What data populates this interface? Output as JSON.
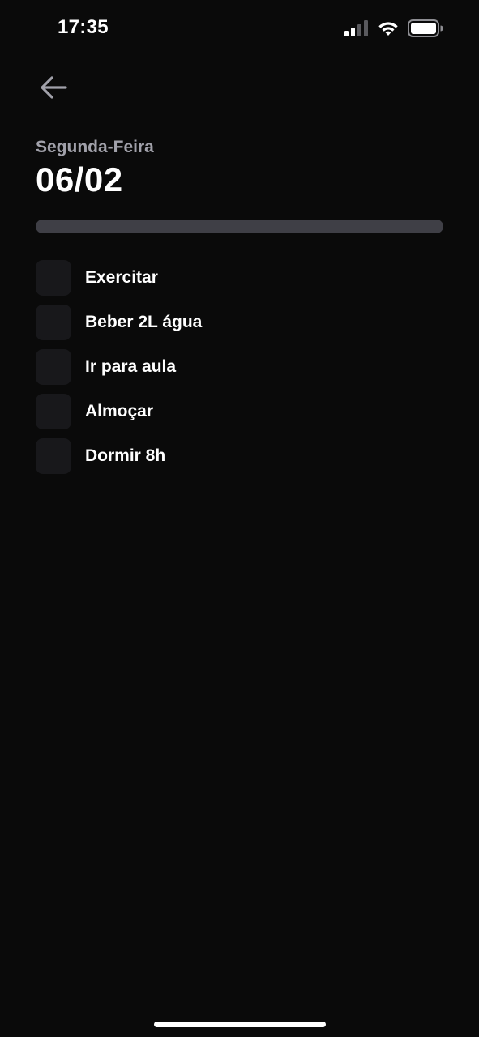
{
  "status_bar": {
    "time": "17:35",
    "icons": [
      "cellular-signal-icon",
      "wifi-icon",
      "battery-icon"
    ]
  },
  "header": {
    "back_icon": "arrow-left-icon",
    "weekday": "Segunda-Feira",
    "date": "06/02"
  },
  "progress": {
    "completed_fraction": 0,
    "track_color": "#3f3f46",
    "fill_color": "#7c3aed"
  },
  "habits": [
    {
      "label": "Exercitar",
      "checked": false
    },
    {
      "label": "Beber 2L água",
      "checked": false
    },
    {
      "label": "Ir para aula",
      "checked": false
    },
    {
      "label": "Almoçar",
      "checked": false
    },
    {
      "label": "Dormir 8h",
      "checked": false
    }
  ],
  "colors": {
    "background": "#0a0a0a",
    "checkbox_bg": "#18181b",
    "muted_text": "#a1a1aa",
    "text": "#ffffff"
  }
}
